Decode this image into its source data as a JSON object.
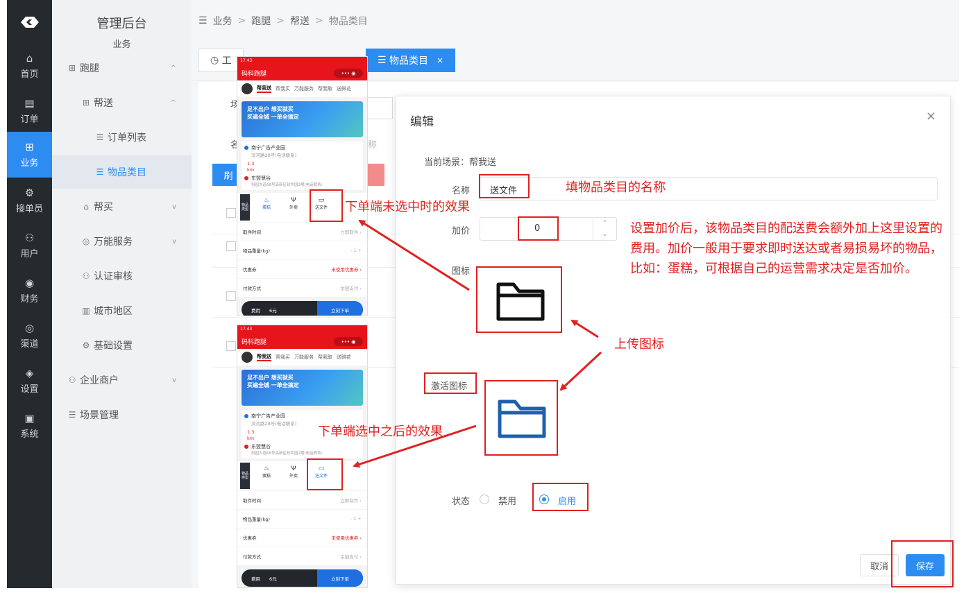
{
  "rail": {
    "items": [
      {
        "label": "首页",
        "icon": "home-icon",
        "glyph": "⌂"
      },
      {
        "label": "订单",
        "icon": "order-icon",
        "glyph": "▤"
      },
      {
        "label": "业务",
        "icon": "grid-icon",
        "glyph": "⊞"
      },
      {
        "label": "接单员",
        "icon": "bike-icon",
        "glyph": "⚙"
      },
      {
        "label": "用户",
        "icon": "user-icon",
        "glyph": "⚇"
      },
      {
        "label": "财务",
        "icon": "money-icon",
        "glyph": "◉"
      },
      {
        "label": "渠道",
        "icon": "channel-icon",
        "glyph": "◎"
      },
      {
        "label": "设置",
        "icon": "settings-icon",
        "glyph": "◈"
      },
      {
        "label": "系统",
        "icon": "system-icon",
        "glyph": "▣"
      }
    ]
  },
  "sidebar": {
    "title": "管理后台",
    "subtitle": "业务",
    "items": [
      {
        "label": "跑腿",
        "glyph": "⊞",
        "icon": "grid-icon",
        "chev": "^"
      },
      {
        "label": "帮送",
        "glyph": "⊞",
        "icon": "grid-icon",
        "chev": "^"
      },
      {
        "label": "订单列表",
        "glyph": "☰",
        "icon": "list-icon",
        "chev": ""
      },
      {
        "label": "物品类目",
        "glyph": "☰",
        "icon": "list-icon",
        "chev": ""
      },
      {
        "label": "帮买",
        "glyph": "⌂",
        "icon": "shop-icon",
        "chev": "v"
      },
      {
        "label": "万能服务",
        "glyph": "◎",
        "icon": "globe-icon",
        "chev": "v"
      },
      {
        "label": "认证审核",
        "glyph": "⚇",
        "icon": "user-icon",
        "chev": ""
      },
      {
        "label": "城市地区",
        "glyph": "▥",
        "icon": "city-icon",
        "chev": ""
      },
      {
        "label": "基础设置",
        "glyph": "⚙",
        "icon": "gear-icon",
        "chev": ""
      },
      {
        "label": "企业商户",
        "glyph": "⚇",
        "icon": "users-icon",
        "chev": "v"
      },
      {
        "label": "场景管理",
        "glyph": "☰",
        "icon": "list-icon",
        "chev": ""
      }
    ]
  },
  "breadcrumb": {
    "toggle": "☰",
    "items": [
      "业务",
      "跑腿",
      "帮送",
      "物品类目"
    ]
  },
  "tabs": {
    "workbench": "工",
    "active": "物品类目",
    "close": "×"
  },
  "background": {
    "refresh_btn": "刷",
    "frag_scene": "场",
    "frag_name": "名",
    "frag_name2": "称"
  },
  "modal": {
    "title": "编辑",
    "close": "×",
    "scene": "当前场景：帮我送",
    "name_label": "名称",
    "name_value": "送文件",
    "price_label": "加价",
    "price_value": "0",
    "price_up": "⌃",
    "price_down": "⌄",
    "icon_label": "图标",
    "active_icon_label": "激活图标",
    "status_label": "状态",
    "status_disabled": "禁用",
    "status_enabled": "启用",
    "cancel": "取消",
    "save": "保存"
  },
  "annotations": {
    "name_hint": "填物品类目的名称",
    "price_hint": "设置加价后，该物品类目的配送费会额外加上这里设置的费用。加价一般用于要求即时送达或者易损易坏的物品，比如：蛋糕，可根据自己的运营需求决定是否加价。",
    "unselected": "下单端未选中时的效果",
    "upload": "上传图标",
    "selected": "下单端选中之后的效果"
  },
  "phone": {
    "status_time": "17:43",
    "app_name": "码科跑腿",
    "capsule": "•••  ◉",
    "tabs": [
      "帮我送",
      "帮我买",
      "万能服务",
      "帮我取",
      "送鲜花"
    ],
    "banner_line1": "足不出户 想买就买",
    "banner_line2": "买遍全城 一单全搞定",
    "from_name": "南宁广告产业园",
    "from_detail": "滨河路28号(电话联系)",
    "distance": "1.3",
    "distance_unit": "km",
    "to_name": "东盟慧谷",
    "to_detail": "科园大道68号高新区软件园2期(电话联系)",
    "cat_tag": "物品类型",
    "cats": [
      {
        "label": "蛋糕",
        "glyph": "♨"
      },
      {
        "label": "外卖",
        "glyph": "Ψ"
      },
      {
        "label": "送文件",
        "glyph": "▭"
      }
    ],
    "rows": [
      {
        "label": "取件时间",
        "value": "立即取件 ›"
      },
      {
        "label": "物品重量(kg)",
        "value": "- 1 +"
      },
      {
        "label": "优惠券",
        "value": "未使用优惠券 ›"
      },
      {
        "label": "付款方式",
        "value": "余额支付 ›"
      }
    ],
    "fee_label": "费用",
    "fee_value": "6元",
    "pay_btn": "立刻下单"
  }
}
